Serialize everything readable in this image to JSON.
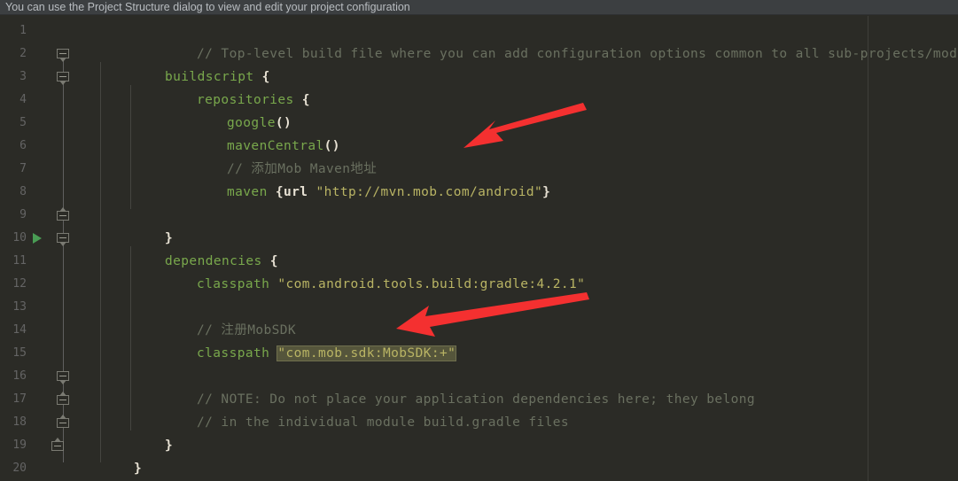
{
  "banner": {
    "text": "You can use the Project Structure dialog to view and edit your project configuration"
  },
  "editor": {
    "first_line": 1,
    "last_line": 20,
    "line_numbers": [
      "1",
      "2",
      "3",
      "4",
      "5",
      "6",
      "7",
      "8",
      "9",
      "10",
      "11",
      "12",
      "13",
      "14",
      "15",
      "16",
      "17",
      "18",
      "19",
      "20"
    ],
    "lines": [
      {
        "n": "1",
        "text": "// Top-level build file where you can add configuration options common to all sub-projects/modules."
      },
      {
        "n": "2",
        "text": "buildscript {"
      },
      {
        "n": "3",
        "text": "    repositories {"
      },
      {
        "n": "4",
        "text": "        google()"
      },
      {
        "n": "5",
        "text": "        mavenCentral()"
      },
      {
        "n": "6",
        "text": "        // 添加Mob Maven地址"
      },
      {
        "n": "7",
        "text": "        maven {url \"http://mvn.mob.com/android\"}"
      },
      {
        "n": "8",
        "text": ""
      },
      {
        "n": "9",
        "text": "    }"
      },
      {
        "n": "10",
        "text": "    dependencies {"
      },
      {
        "n": "11",
        "text": "        classpath \"com.android.tools.build:gradle:4.2.1\""
      },
      {
        "n": "12",
        "text": ""
      },
      {
        "n": "13",
        "text": "        // 注册MobSDK"
      },
      {
        "n": "14",
        "text": "        classpath \"com.mob.sdk:MobSDK:+\""
      },
      {
        "n": "15",
        "text": ""
      },
      {
        "n": "16",
        "text": "        // NOTE: Do not place your application dependencies here; they belong"
      },
      {
        "n": "17",
        "text": "        // in the individual module build.gradle files"
      },
      {
        "n": "18",
        "text": "    }"
      },
      {
        "n": "19",
        "text": "}"
      },
      {
        "n": "20",
        "text": ""
      }
    ],
    "tokens": {
      "line1_comment": "// Top-level build file where you can add configuration options common to all sub-projects/modules.",
      "line2_kw": "buildscript",
      "line2_brace": " {",
      "line3_kw": "repositories",
      "line3_brace": " {",
      "line4_fn": "google",
      "line4_parens": "()",
      "line5_fn": "mavenCentral",
      "line5_parens": "()",
      "line6_comment": "// 添加Mob Maven地址",
      "line7_fn": "maven",
      "line7_open": " {url ",
      "line7_str": "\"http://mvn.mob.com/android\"",
      "line7_close": "}",
      "line9_brace": "}",
      "line10_kw": "dependencies",
      "line10_brace": " {",
      "line11_fn": "classpath",
      "line11_str": "\"com.android.tools.build:gradle:4.2.1\"",
      "line13_comment": "// 注册MobSDK",
      "line14_fn": "classpath",
      "line14_str": "\"com.mob.sdk:MobSDK:+\"",
      "line16_comment": "// NOTE: Do not place your application dependencies here; they belong",
      "line17_comment": "// in the individual module build.gradle files",
      "line18_brace": "}",
      "line19_brace": "}"
    },
    "run_gutter_line": "10"
  },
  "annotations": {
    "arrow_color": "#f43030",
    "arrow_top_label": "arrow pointing at maven url line",
    "arrow_bottom_label": "arrow pointing at MobSDK classpath line"
  },
  "colors": {
    "editor_background": "#2b2b26",
    "banner_background": "#3c3f41",
    "comment": "#6a7060",
    "keyword": "#a9b7c6",
    "function": "#79a84c",
    "string": "#b9b464",
    "highlight_background": "#55553b",
    "run_arrow": "#499c54",
    "line_number": "#646464"
  }
}
